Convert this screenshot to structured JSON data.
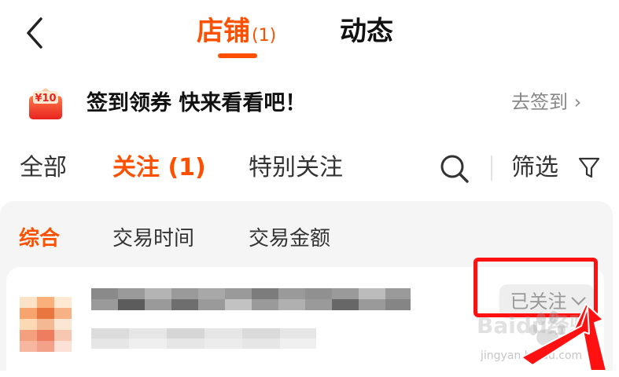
{
  "header": {
    "tab_store": "店铺",
    "tab_store_count": "(1)",
    "tab_feed": "动态"
  },
  "promo": {
    "badge": "¥10",
    "text": "签到领券  快来看看吧！",
    "link": "去签到 ›"
  },
  "filters": {
    "tabs": [
      "全部",
      "关注 (1)",
      "特别关注"
    ],
    "filter_label": "筛选"
  },
  "sort": {
    "tabs": [
      "综合",
      "交易时间",
      "交易金额"
    ]
  },
  "shop": {
    "follow_status": "已关注"
  },
  "watermark": {
    "logo_text": "Baidu经验",
    "url": "jingyan.baidu.com"
  },
  "colors": {
    "accent": "#ff5000",
    "highlight": "#ff1111",
    "panel_bg": "#f5f5f5"
  }
}
